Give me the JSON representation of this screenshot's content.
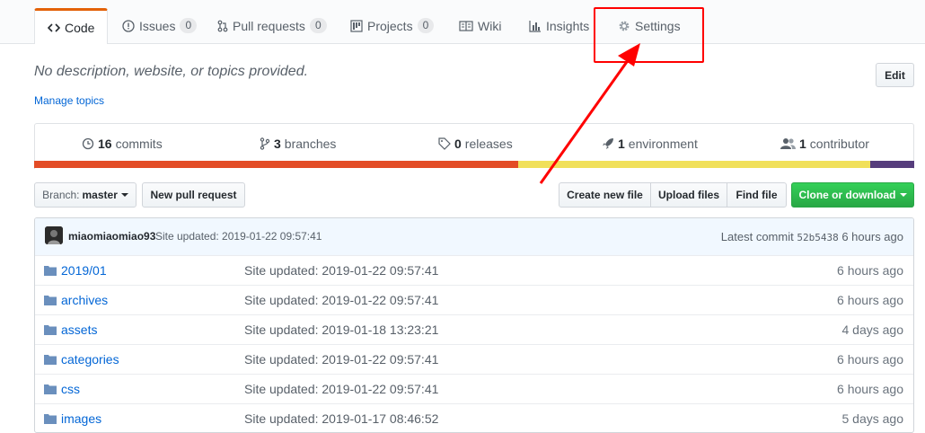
{
  "tabs": [
    {
      "label": "Code",
      "icon": "code-icon"
    },
    {
      "label": "Issues",
      "icon": "issue-icon",
      "count": "0"
    },
    {
      "label": "Pull requests",
      "icon": "pull-request-icon",
      "count": "0"
    },
    {
      "label": "Projects",
      "icon": "project-icon",
      "count": "0"
    },
    {
      "label": "Wiki",
      "icon": "book-icon"
    },
    {
      "label": "Insights",
      "icon": "graph-icon"
    },
    {
      "label": "Settings",
      "icon": "gear-icon"
    }
  ],
  "repo": {
    "description": "No description, website, or topics provided.",
    "manage_topics": "Manage topics",
    "edit": "Edit"
  },
  "summary": {
    "commits": {
      "count": "16",
      "label": "commits"
    },
    "branches": {
      "count": "3",
      "label": "branches"
    },
    "releases": {
      "count": "0",
      "label": "releases"
    },
    "environment": {
      "count": "1",
      "label": "environment"
    },
    "contributors": {
      "count": "1",
      "label": "contributor"
    }
  },
  "language_bar": [
    {
      "color": "#e34c26",
      "share": 55
    },
    {
      "color": "#f1e05a",
      "share": 40
    },
    {
      "color": "#563d7c",
      "share": 5
    }
  ],
  "toolbar": {
    "branch_prefix": "Branch:",
    "branch_name": "master",
    "new_pull_request": "New pull request",
    "create_new_file": "Create new file",
    "upload_files": "Upload files",
    "find_file": "Find file",
    "clone_or_download": "Clone or download"
  },
  "commit": {
    "author": "miaomiaomiao93",
    "message": "Site updated: 2019-01-22 09:57:41",
    "latest_label": "Latest commit",
    "sha": "52b5438",
    "time": "6 hours ago"
  },
  "files": [
    {
      "name": "2019/01",
      "message": "Site updated: 2019-01-22 09:57:41",
      "age": "6 hours ago"
    },
    {
      "name": "archives",
      "message": "Site updated: 2019-01-22 09:57:41",
      "age": "6 hours ago"
    },
    {
      "name": "assets",
      "message": "Site updated: 2019-01-18 13:23:21",
      "age": "4 days ago"
    },
    {
      "name": "categories",
      "message": "Site updated: 2019-01-22 09:57:41",
      "age": "6 hours ago"
    },
    {
      "name": "css",
      "message": "Site updated: 2019-01-22 09:57:41",
      "age": "6 hours ago"
    },
    {
      "name": "images",
      "message": "Site updated: 2019-01-17 08:46:52",
      "age": "5 days ago"
    }
  ],
  "colors": {
    "accent_tab": "#e36209",
    "link": "#0366d6",
    "green_button": "#28a745",
    "annotation": "#ff0000"
  }
}
